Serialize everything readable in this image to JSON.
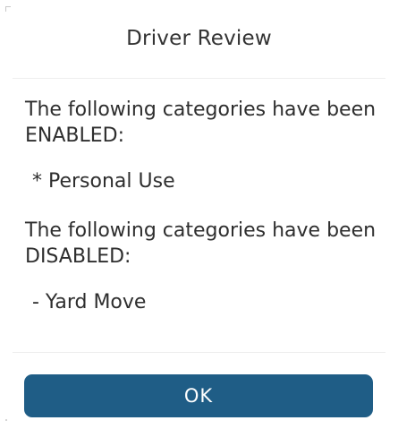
{
  "dialog": {
    "title": "Driver Review",
    "enabled_intro": "The following categories have been ENABLED:",
    "enabled_items": [
      "* Personal Use"
    ],
    "disabled_intro": "The following categories have been DISABLED:",
    "disabled_items": [
      "- Yard Move"
    ],
    "ok_label": "OK"
  },
  "colors": {
    "button_bg": "#1f5d86",
    "button_text": "#ffffff",
    "text": "#2e2e2e"
  }
}
